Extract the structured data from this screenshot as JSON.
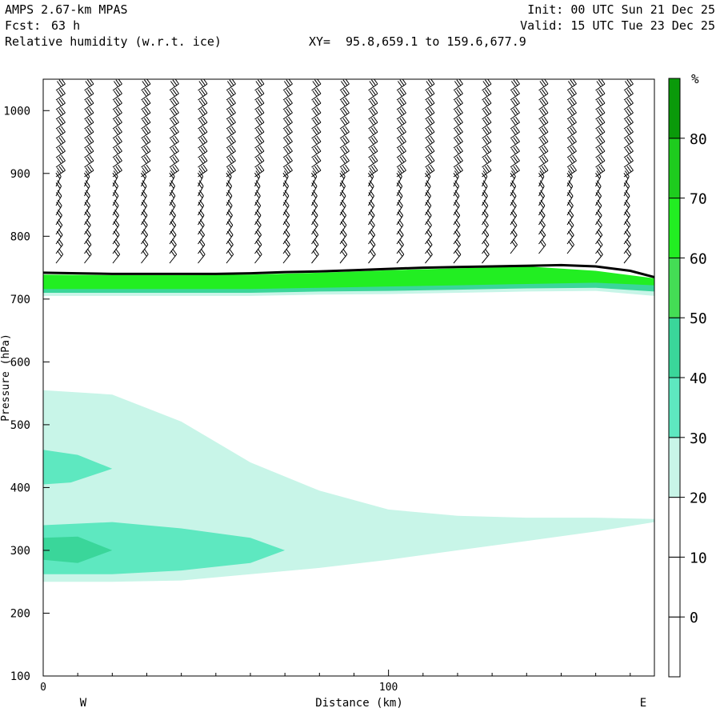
{
  "header": {
    "model": "AMPS 2.67-km MPAS",
    "forecast_label": "Fcst:",
    "forecast_value": "63 h",
    "field": "Relative humidity (w.r.t. ice)",
    "xy_label": "XY=",
    "xy_value": "95.8,659.1 to 159.6,677.9",
    "init": "Init: 00 UTC Sun 21 Dec 25",
    "valid": "Valid: 15 UTC Tue 23 Dec 25"
  },
  "chart_data": {
    "type": "heatmap",
    "title": "Relative humidity (w.r.t. ice)",
    "xlabel": "Distance (km)",
    "ylabel": "Pressure (hPa)",
    "xlim": [
      0,
      177
    ],
    "ylim": [
      1050,
      100
    ],
    "x_ticks": [
      0,
      100
    ],
    "y_ticks": [
      100,
      200,
      300,
      400,
      500,
      600,
      700,
      800,
      900,
      1000
    ],
    "x_end_labels": {
      "left": "W",
      "right": "E"
    },
    "colorbar": {
      "unit": "%",
      "levels": [
        0,
        10,
        20,
        30,
        40,
        50,
        60,
        70,
        80
      ],
      "colors": [
        "#ffffff",
        "#ffffff",
        "#ffffff",
        "#c8f5e8",
        "#5ee8c0",
        "#3ad69a",
        "#44dd55",
        "#22ee22",
        "#1ecc1e",
        "#0a9a0a"
      ]
    },
    "rh_regions": [
      {
        "level": 30,
        "color": "#c8f5e8",
        "x": [
          0,
          20,
          40,
          60,
          80,
          100,
          120,
          140,
          160,
          177,
          177,
          160,
          140,
          120,
          100,
          80,
          60,
          40,
          20,
          0
        ],
        "p": [
          250,
          250,
          252,
          262,
          272,
          285,
          300,
          315,
          330,
          345,
          350,
          352,
          352,
          355,
          365,
          395,
          440,
          505,
          548,
          555
        ]
      },
      {
        "level": 40,
        "color": "#5ee8c0",
        "x": [
          0,
          20,
          40,
          60,
          70,
          60,
          40,
          20,
          0
        ],
        "p": [
          262,
          262,
          268,
          280,
          300,
          320,
          335,
          345,
          340
        ]
      },
      {
        "level": 40,
        "color": "#5ee8c0",
        "x": [
          0,
          8,
          20,
          10,
          0
        ],
        "p": [
          405,
          408,
          430,
          452,
          460
        ]
      },
      {
        "level": 50,
        "color": "#3ad69a",
        "x": [
          0,
          10,
          20,
          10,
          0
        ],
        "p": [
          285,
          280,
          300,
          322,
          320
        ]
      },
      {
        "level": 30,
        "color": "#c8f5e8",
        "x": [
          0,
          20,
          40,
          60,
          80,
          100,
          120,
          140,
          160,
          177,
          177,
          160,
          140,
          120,
          100,
          80,
          60,
          40,
          20,
          0
        ],
        "p": [
          705,
          705,
          705,
          705,
          707,
          708,
          710,
          712,
          713,
          705,
          730,
          740,
          750,
          748,
          745,
          740,
          738,
          737,
          737,
          738
        ]
      },
      {
        "level": 50,
        "color": "#3ad69a",
        "x": [
          0,
          20,
          40,
          60,
          80,
          100,
          120,
          140,
          160,
          177,
          177,
          160,
          140,
          120,
          100,
          80,
          60,
          40,
          20,
          0
        ],
        "p": [
          710,
          710,
          710,
          710,
          712,
          713,
          715,
          717,
          718,
          712,
          730,
          742,
          750,
          748,
          745,
          740,
          738,
          737,
          737,
          738
        ]
      },
      {
        "level": 70,
        "color": "#22ee22",
        "x": [
          0,
          20,
          40,
          60,
          80,
          100,
          120,
          140,
          160,
          177,
          177,
          160,
          140,
          120,
          100,
          80,
          60,
          40,
          20,
          0
        ],
        "p": [
          716,
          716,
          716,
          716,
          718,
          720,
          722,
          724,
          726,
          722,
          733,
          745,
          752,
          749,
          746,
          742,
          739,
          738,
          738,
          739
        ]
      }
    ],
    "terrain": {
      "x": [
        0,
        10,
        20,
        30,
        40,
        50,
        60,
        70,
        80,
        90,
        100,
        110,
        120,
        130,
        140,
        150,
        160,
        170,
        177
      ],
      "p": [
        742,
        741,
        740,
        740,
        740,
        740,
        741,
        743,
        744,
        746,
        748,
        750,
        751,
        752,
        753,
        754,
        752,
        745,
        735
      ]
    }
  }
}
